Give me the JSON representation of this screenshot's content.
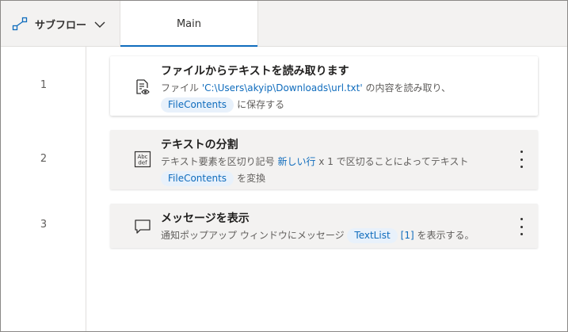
{
  "header": {
    "subflow_label": "サブフロー",
    "tabs": [
      {
        "label": "Main",
        "active": true
      }
    ]
  },
  "accent_color": "#0f6cbd",
  "actions": [
    {
      "line": "1",
      "icon": "read-text-file-icon",
      "title": "ファイルからテキストを読み取ります",
      "desc_pre": "ファイル ",
      "desc_token": "'C:\\Users\\akyip\\Downloads\\url.txt'",
      "desc_post": " の内容を読み取り、",
      "var": "FileContents",
      "desc_tail": "に保存する"
    },
    {
      "line": "2",
      "icon": "split-text-icon",
      "title": "テキストの分割",
      "desc_pre": "テキスト要素を区切り記号 ",
      "desc_token": "新しい行",
      "desc_post": " x 1 で区切ることによってテキスト",
      "var": "FileContents",
      "desc_tail": "を変換"
    },
    {
      "line": "3",
      "icon": "message-box-icon",
      "title": "メッセージを表示",
      "desc_pre": "通知ポップアップ ウィンドウにメッセージ ",
      "var": "TextList",
      "index": "[1]",
      "desc_tail": "を表示する。"
    }
  ]
}
